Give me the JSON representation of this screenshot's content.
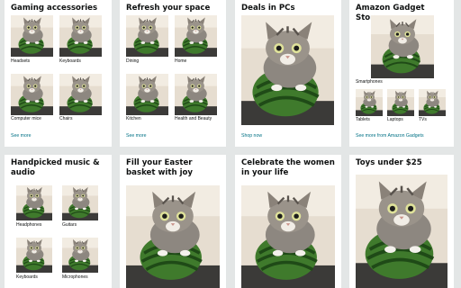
{
  "cards": [
    {
      "title": "Gaming accessories",
      "tiles": [
        "Headsets",
        "Keyboards",
        "Computer mice",
        "Chairs"
      ],
      "see_more": "See more"
    },
    {
      "title": "Refresh your space",
      "tiles": [
        "Dining",
        "Home",
        "Kitchen",
        "Health and Beauty"
      ],
      "see_more": "See more"
    },
    {
      "title": "Deals in PCs",
      "see_more": "Shop now"
    },
    {
      "title": "Amazon Gadget Store",
      "hero_label": "Smartphones",
      "tiles": [
        "Tablets",
        "Laptops",
        "TVs"
      ],
      "see_more": "See more from Amazon Gadgets"
    },
    {
      "title": "Handpicked music & audio",
      "tiles": [
        "Headphones",
        "Guitars",
        "Keyboards",
        "Microphones"
      ]
    },
    {
      "title": "Fill your Easter basket with joy"
    },
    {
      "title": "Celebrate the women in your life"
    },
    {
      "title": "Toys under $25"
    }
  ],
  "colors": {
    "page_bg": "#e3e6e6",
    "card_bg": "#ffffff",
    "link": "#007185",
    "text": "#0f1111"
  }
}
